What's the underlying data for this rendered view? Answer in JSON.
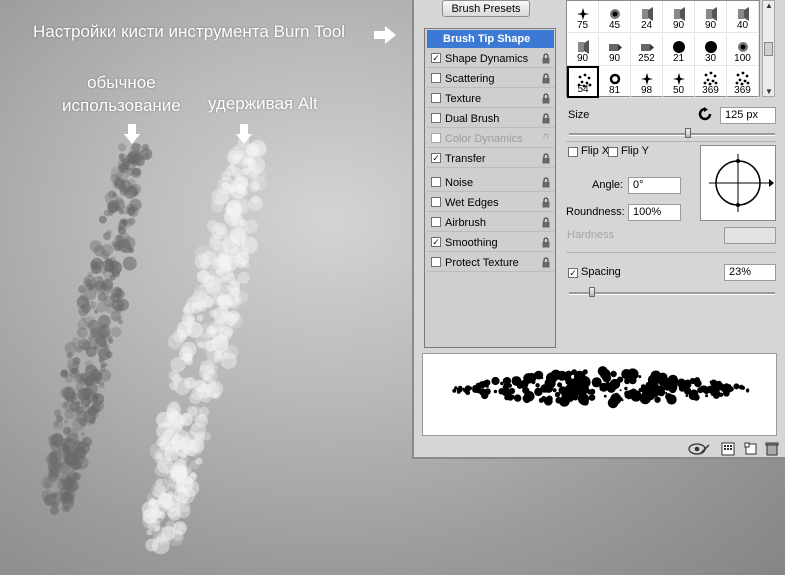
{
  "annotations": {
    "title": "Настройки кисти инструмента Burn Tool",
    "normal_line1": "обычное",
    "normal_line2": "использование",
    "alt": "удерживая  Alt"
  },
  "panel": {
    "brush_presets_button": "Brush Presets",
    "options": [
      {
        "label": "Brush Tip Shape",
        "checked": null,
        "selected": true,
        "disabled": false
      },
      {
        "label": "Shape Dynamics",
        "checked": true,
        "selected": false,
        "disabled": false
      },
      {
        "label": "Scattering",
        "checked": false,
        "selected": false,
        "disabled": false
      },
      {
        "label": "Texture",
        "checked": false,
        "selected": false,
        "disabled": false
      },
      {
        "label": "Dual Brush",
        "checked": false,
        "selected": false,
        "disabled": false
      },
      {
        "label": "Color Dynamics",
        "checked": false,
        "selected": false,
        "disabled": true
      },
      {
        "label": "Transfer",
        "checked": true,
        "selected": false,
        "disabled": false
      },
      {
        "label": "Noise",
        "checked": false,
        "selected": false,
        "disabled": false
      },
      {
        "label": "Wet Edges",
        "checked": false,
        "selected": false,
        "disabled": false
      },
      {
        "label": "Airbrush",
        "checked": false,
        "selected": false,
        "disabled": false
      },
      {
        "label": "Smoothing",
        "checked": true,
        "selected": false,
        "disabled": false
      },
      {
        "label": "Protect Texture",
        "checked": false,
        "selected": false,
        "disabled": false
      }
    ],
    "preset_rows": [
      [
        "75",
        "45",
        "24",
        "90",
        "90",
        "40"
      ],
      [
        "90",
        "90",
        "252",
        "21",
        "30",
        "100"
      ],
      [
        "54",
        "81",
        "98",
        "50",
        "369",
        "369"
      ]
    ],
    "preset_icons": [
      [
        "star-brush-icon",
        "soft-round-icon",
        "spray-nozzle-icon",
        "spray-nozzle-icon",
        "spray-nozzle-icon",
        "spray-nozzle-icon"
      ],
      [
        "spray-nozzle-icon",
        "chisel-tip-icon",
        "chisel-tip-icon",
        "hard-round-icon",
        "hard-round-icon",
        "soft-round-icon"
      ],
      [
        "scatter-dots-icon",
        "ring-brush-icon",
        "star-brush-icon",
        "star-brush-icon",
        "scatter-dots-icon",
        "scatter-dots-icon"
      ]
    ],
    "selected_preset": "54",
    "size_label": "Size",
    "size_value": "125 px",
    "size_slider_fraction": 0.58,
    "flip_x": "Flip X",
    "flip_y": "Flip Y",
    "angle_label": "Angle:",
    "angle_value": "0°",
    "roundness_label": "Roundness:",
    "roundness_value": "100%",
    "hardness_label": "Hardness",
    "spacing_label": "Spacing",
    "spacing_checked": true,
    "spacing_value": "23%",
    "spacing_slider_fraction": 0.11
  },
  "colors": {
    "selection": "#3c79d4",
    "panel_bg": "#d6d6d6"
  }
}
